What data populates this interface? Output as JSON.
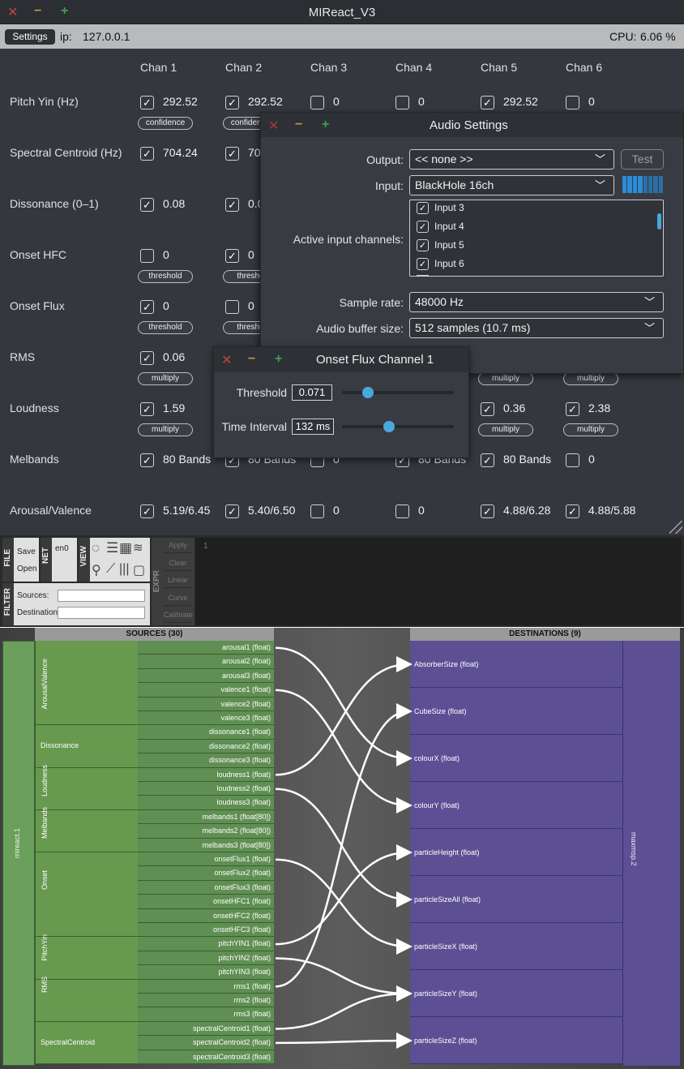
{
  "window": {
    "title": "MIReact_V3"
  },
  "toolbar": {
    "settings": "Settings",
    "ip_label": "ip:",
    "ip_value": "127.0.0.1",
    "cpu_label": "CPU:",
    "cpu_value": "6.06 %"
  },
  "channels": [
    "Chan 1",
    "Chan 2",
    "Chan 3",
    "Chan 4",
    "Chan 5",
    "Chan 6"
  ],
  "features": [
    {
      "label": "Pitch Yin (Hz)",
      "cells": [
        {
          "on": true,
          "v": "292.52",
          "btn": "confidence"
        },
        {
          "on": true,
          "v": "292.52",
          "btn": "confidence"
        },
        {
          "on": false,
          "v": "0"
        },
        {
          "on": false,
          "v": "0"
        },
        {
          "on": true,
          "v": "292.52"
        },
        {
          "on": false,
          "v": "0"
        }
      ]
    },
    {
      "label": "Spectral Centroid (Hz)",
      "cells": [
        {
          "on": true,
          "v": "704.24"
        },
        {
          "on": true,
          "v": "70"
        }
      ]
    },
    {
      "label": "Dissonance (0–1)",
      "cells": [
        {
          "on": true,
          "v": "0.08"
        },
        {
          "on": true,
          "v": "0.0"
        }
      ]
    },
    {
      "label": "Onset HFC",
      "cells": [
        {
          "on": false,
          "v": "0",
          "btn": "threshold"
        },
        {
          "on": true,
          "v": "0",
          "btn": "thresho"
        }
      ]
    },
    {
      "label": "Onset Flux",
      "cells": [
        {
          "on": true,
          "v": "0",
          "btn": "threshold"
        },
        {
          "on": false,
          "v": "0",
          "btn": "thresho"
        }
      ]
    },
    {
      "label": "RMS",
      "cells": [
        {
          "on": true,
          "v": "0.06",
          "btn": "multiply"
        },
        null,
        null,
        null,
        {
          "btn": "multiply"
        },
        {
          "btn": "multiply"
        }
      ]
    },
    {
      "label": "Loudness",
      "cells": [
        {
          "on": true,
          "v": "1.59",
          "btn": "multiply"
        },
        null,
        null,
        null,
        {
          "on": true,
          "v": "0.36",
          "btn": "multiply"
        },
        {
          "on": true,
          "v": "2.38",
          "btn": "multiply"
        }
      ]
    },
    {
      "label": "Melbands",
      "cells": [
        {
          "on": true,
          "v": "80 Bands"
        },
        {
          "on": true,
          "v": "80 Bands"
        },
        {
          "on": false,
          "v": "0"
        },
        {
          "on": true,
          "v": "80 Bands"
        },
        {
          "on": true,
          "v": "80 Bands"
        },
        {
          "on": false,
          "v": "0"
        }
      ]
    },
    {
      "label": "Arousal/Valence",
      "cells": [
        {
          "on": true,
          "v": "5.19/6.45"
        },
        {
          "on": true,
          "v": "5.40/6.50"
        },
        {
          "on": false,
          "v": "0"
        },
        {
          "on": false,
          "v": "0"
        },
        {
          "on": true,
          "v": "4.88/6.28"
        },
        {
          "on": true,
          "v": "4.88/5.88"
        }
      ]
    }
  ],
  "audio_settings": {
    "title": "Audio Settings",
    "output_label": "Output:",
    "output_value": "<< none >>",
    "test": "Test",
    "input_label": "Input:",
    "input_value": "BlackHole 16ch",
    "channels_label": "Active input channels:",
    "channels": [
      "Input 3",
      "Input 4",
      "Input 5",
      "Input 6"
    ],
    "rate_label": "Sample rate:",
    "rate_value": "48000 Hz",
    "buffer_label": "Audio buffer size:",
    "buffer_value": "512 samples (10.7 ms)"
  },
  "onset_flux": {
    "title": "Onset Flux Channel 1",
    "threshold_label": "Threshold",
    "threshold_value": "0.071",
    "threshold_level": 0.23,
    "interval_label": "Time Interval",
    "interval_value": "132 ms",
    "interval_level": 0.42
  },
  "mapper": {
    "file": "FILE",
    "save": "Save",
    "open": "Open",
    "net": "NET",
    "net_value": "en0",
    "view": "VIEW",
    "filter": "FILTER",
    "sources_label": "Sources:",
    "destinations_label": "Destinations:",
    "expr": "EXPR",
    "expr_buttons": [
      "Apply",
      "Clear",
      "Linear",
      "Curve",
      "Calibrate"
    ],
    "line_number": "1",
    "sources_header": "SOURCES (30)",
    "destinations_header": "DESTINATIONS (9)",
    "source_device": "mireact.1",
    "dest_device": "maxmsp.2",
    "groups": [
      "ArousalValence",
      "Dissonance",
      "Loudness",
      "Melbands",
      "Onset",
      "PitchYin",
      "RMS",
      "SpectralCentroid"
    ],
    "sources": [
      "arousal1 (float)",
      "arousal2 (float)",
      "arousal3 (float)",
      "valence1 (float)",
      "valence2 (float)",
      "valence3 (float)",
      "dissonance1 (float)",
      "dissonance2 (float)",
      "dissonance3 (float)",
      "loudness1 (float)",
      "loudness2 (float)",
      "loudness3 (float)",
      "melbands1 (float[80])",
      "melbands2 (float[80])",
      "melbands3 (float[80])",
      "onsetFlux1 (float)",
      "onsetFlux2 (float)",
      "onsetFlux3 (float)",
      "onsetHFC1 (float)",
      "onsetHFC2 (float)",
      "onsetHFC3 (float)",
      "pitchYIN1 (float)",
      "pitchYIN2 (float)",
      "pitchYIN3 (float)",
      "rms1 (float)",
      "rms2 (float)",
      "rms3 (float)",
      "spectralCentroid1 (float)",
      "spectralCentroid2 (float)",
      "spectralCentroid3 (float)"
    ],
    "destinations": [
      "AbsorberSize (float)",
      "CubeSize (float)",
      "colourX (float)",
      "colourY (float)",
      "particleHeight (float)",
      "particleSizeAll (float)",
      "particleSizeX (float)",
      "particleSizeY (float)",
      "particleSizeZ (float)"
    ]
  }
}
